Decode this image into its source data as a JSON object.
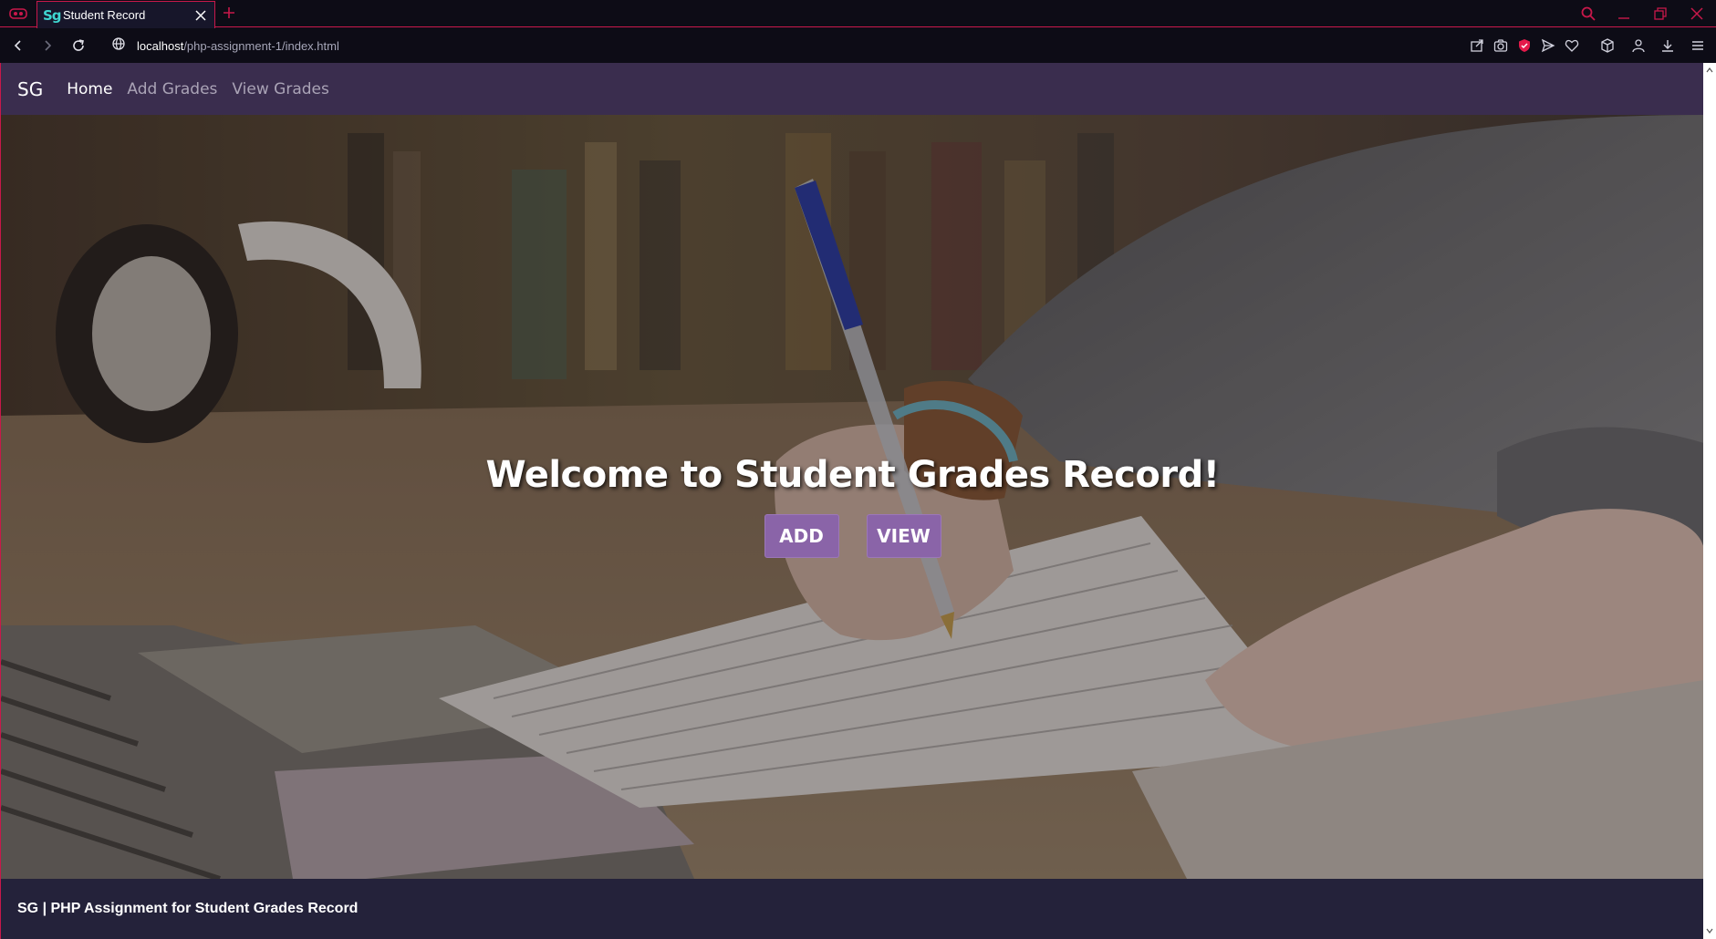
{
  "browser": {
    "tab": {
      "favicon_text": "Sg",
      "title": "Student Record"
    },
    "url": {
      "host": "localhost",
      "path": "/php-assignment-1/index.html"
    },
    "accent_color": "#c8184a"
  },
  "site": {
    "brand": "SG",
    "nav": [
      {
        "label": "Home",
        "active": true
      },
      {
        "label": "Add Grades",
        "active": false
      },
      {
        "label": "View Grades",
        "active": false
      }
    ],
    "hero": {
      "title": "Welcome to Student Grades Record!",
      "buttons": {
        "add": "ADD",
        "view": "VIEW"
      },
      "button_color": "#8a64a8"
    },
    "footer": {
      "text": "SG | PHP Assignment for Student Grades Record"
    },
    "nav_color": "#3a2d4e",
    "footer_color": "#24223a"
  }
}
